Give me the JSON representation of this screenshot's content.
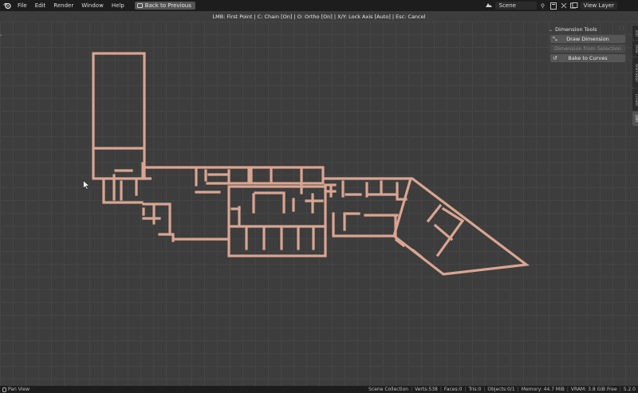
{
  "menu": {
    "logo_icon": "blender-logo-icon",
    "items": [
      "File",
      "Edit",
      "Render",
      "Window",
      "Help"
    ],
    "back_button": "Back to Previous"
  },
  "topbar_right": {
    "scene_icon": "scene-icon",
    "scene_name": "Scene",
    "view_layer_name": "View Layer"
  },
  "header_hint": "LMB: First Point | C: Chain [On] | O: Ortho [On] | X/Y: Lock Axis [Auto] | Esc: Cancel",
  "panel": {
    "title": "Dimension Tools",
    "buttons": [
      {
        "label": "Draw Dimension",
        "enabled": true,
        "icon": "measure-icon"
      },
      {
        "label": "Dimension from Selection",
        "enabled": false,
        "icon": ""
      },
      {
        "label": "Bake to Curves",
        "enabled": true,
        "icon": "curve-icon"
      }
    ]
  },
  "side_tabs": [
    {
      "label": "Tool",
      "active": false
    },
    {
      "label": "View",
      "active": false
    },
    {
      "label": "Animation",
      "active": false
    },
    {
      "label": "Create",
      "active": false
    },
    {
      "label": "Dim",
      "active": true
    }
  ],
  "status": {
    "left": "Pan View",
    "collection": "Scene Collection",
    "verts": "Verts:538",
    "faces": "Faces:0",
    "tris": "Tris:0",
    "objects": "Objects:0/1",
    "memory": "Memory: 44.7 MiB",
    "vram": "VRAM: 3.8 GiB Free",
    "version": "5.2.0"
  },
  "colors": {
    "wall": "#d9a591",
    "background": "#3d3d3d",
    "grid": "#444444",
    "topbar": "#1d1d1d"
  }
}
